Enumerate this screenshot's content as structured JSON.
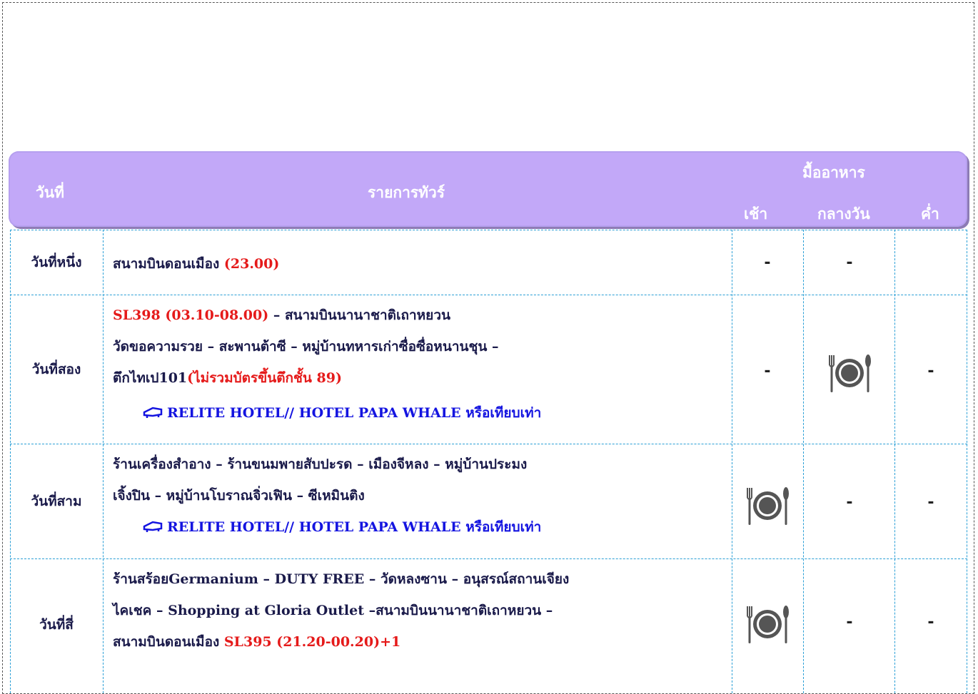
{
  "header": {
    "day_col": "วันที่",
    "program_col": "รายการทัวร์",
    "meals_group": "มื้ออาหาร",
    "breakfast": "เช้า",
    "lunch": "กลางวัน",
    "dinner": "ค่ำ"
  },
  "rows": [
    {
      "day": "วันที่หนึ่ง",
      "line1_text": "สนามบินดอนเมือง  ",
      "line1_red": "(23.00)",
      "breakfast": "-",
      "lunch": "-",
      "dinner": ""
    },
    {
      "day": "วันที่สอง",
      "line1_red": "SL398 (03.10-08.00)",
      "line1_text": " – สนามบินนานาชาติเถาหยวน",
      "line2_text": "วัดขอความรวย – สะพานต้าซี – หมู่บ้านทหารเก่าซื่อซื่อหนานชุน –",
      "line3_text": "ตึกไทเป101",
      "line3_red": "(ไม่รวมบัตรขึ้นตึกชั้น 89)",
      "hotel": "RELITE HOTEL// HOTEL PAPA WHALE หรือเทียบเท่า",
      "breakfast": "-",
      "lunch_icon": "plate-fork-knife-icon",
      "dinner": "-"
    },
    {
      "day": "วันที่สาม",
      "line1_text": "ร้านเครื่องสำอาง – ร้านขนมพายสับปะรด – เมืองจีหลง – หมู่บ้านประมง",
      "line2_text": "เจิ้งปิน – หมู่บ้านโบราณจิ่วเฟิน – ซีเหมินติง",
      "hotel": "RELITE HOTEL// HOTEL PAPA WHALE หรือเทียบเท่า",
      "breakfast_icon": "plate-fork-knife-icon",
      "lunch": "-",
      "dinner": "-"
    },
    {
      "day": "วันที่สี่",
      "line1_text": "ร้านสร้อยGermanium – DUTY FREE – วัดหลงซาน – อนุสรณ์สถานเจียง",
      "line2_text": "ไคเชค – Shopping at Gloria Outlet –สนามบินนานาชาติเถาหยวน –",
      "line3_text": "สนามบินดอนเมือง ",
      "line3_red": "SL395 (21.20-00.20)+1",
      "breakfast_icon": "plate-fork-knife-icon",
      "lunch": "-",
      "dinner": "-"
    }
  ],
  "colors": {
    "header_bg": "#c2a8f8",
    "border": "#2a9fd6",
    "accent_red": "#e51a1a",
    "hotel_blue": "#1414e0"
  }
}
